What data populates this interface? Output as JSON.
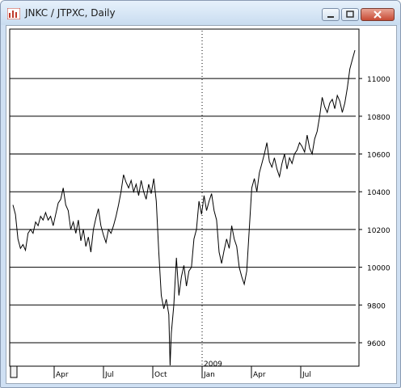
{
  "window": {
    "title": "JNKC / JTPXC, Daily",
    "controls": [
      "minimize",
      "maximize",
      "close"
    ],
    "close_color": "#c74a34"
  },
  "chart_data": {
    "type": "line",
    "series": [
      {
        "points": [
          [
            0,
            10330
          ],
          [
            2,
            10280
          ],
          [
            4,
            10150
          ],
          [
            6,
            10100
          ],
          [
            8,
            10120
          ],
          [
            10,
            10090
          ],
          [
            12,
            10180
          ],
          [
            14,
            10200
          ],
          [
            16,
            10180
          ],
          [
            18,
            10240
          ],
          [
            20,
            10220
          ],
          [
            22,
            10270
          ],
          [
            24,
            10250
          ],
          [
            26,
            10290
          ],
          [
            28,
            10250
          ],
          [
            30,
            10270
          ],
          [
            32,
            10220
          ],
          [
            34,
            10280
          ],
          [
            36,
            10340
          ],
          [
            38,
            10360
          ],
          [
            40,
            10420
          ],
          [
            42,
            10330
          ],
          [
            44,
            10300
          ],
          [
            46,
            10200
          ],
          [
            48,
            10240
          ],
          [
            50,
            10180
          ],
          [
            52,
            10250
          ],
          [
            54,
            10140
          ],
          [
            56,
            10200
          ],
          [
            58,
            10110
          ],
          [
            60,
            10160
          ],
          [
            62,
            10080
          ],
          [
            64,
            10200
          ],
          [
            66,
            10260
          ],
          [
            68,
            10310
          ],
          [
            70,
            10220
          ],
          [
            72,
            10170
          ],
          [
            74,
            10130
          ],
          [
            76,
            10200
          ],
          [
            78,
            10180
          ],
          [
            80,
            10220
          ],
          [
            82,
            10270
          ],
          [
            84,
            10330
          ],
          [
            86,
            10400
          ],
          [
            88,
            10490
          ],
          [
            90,
            10450
          ],
          [
            92,
            10420
          ],
          [
            94,
            10460
          ],
          [
            96,
            10400
          ],
          [
            98,
            10440
          ],
          [
            100,
            10380
          ],
          [
            102,
            10460
          ],
          [
            104,
            10400
          ],
          [
            106,
            10360
          ],
          [
            108,
            10440
          ],
          [
            110,
            10390
          ],
          [
            112,
            10470
          ],
          [
            114,
            10350
          ],
          [
            116,
            10080
          ],
          [
            118,
            9850
          ],
          [
            120,
            9780
          ],
          [
            122,
            9830
          ],
          [
            124,
            9750
          ],
          [
            125,
            9480
          ],
          [
            126,
            9650
          ],
          [
            128,
            9800
          ],
          [
            130,
            10050
          ],
          [
            132,
            9850
          ],
          [
            134,
            9950
          ],
          [
            136,
            10010
          ],
          [
            138,
            9900
          ],
          [
            140,
            9980
          ],
          [
            142,
            10000
          ],
          [
            144,
            10150
          ],
          [
            146,
            10200
          ],
          [
            148,
            10350
          ],
          [
            150,
            10280
          ],
          [
            152,
            10380
          ],
          [
            154,
            10300
          ],
          [
            156,
            10350
          ],
          [
            158,
            10390
          ],
          [
            160,
            10300
          ],
          [
            162,
            10250
          ],
          [
            164,
            10080
          ],
          [
            166,
            10020
          ],
          [
            168,
            10090
          ],
          [
            170,
            10150
          ],
          [
            172,
            10100
          ],
          [
            174,
            10220
          ],
          [
            176,
            10150
          ],
          [
            178,
            10110
          ],
          [
            180,
            10000
          ],
          [
            182,
            9950
          ],
          [
            184,
            9910
          ],
          [
            186,
            9980
          ],
          [
            188,
            10200
          ],
          [
            190,
            10420
          ],
          [
            192,
            10470
          ],
          [
            194,
            10400
          ],
          [
            196,
            10500
          ],
          [
            198,
            10550
          ],
          [
            200,
            10600
          ],
          [
            202,
            10660
          ],
          [
            204,
            10560
          ],
          [
            206,
            10530
          ],
          [
            208,
            10580
          ],
          [
            210,
            10520
          ],
          [
            212,
            10480
          ],
          [
            214,
            10550
          ],
          [
            216,
            10600
          ],
          [
            218,
            10520
          ],
          [
            220,
            10580
          ],
          [
            222,
            10550
          ],
          [
            224,
            10600
          ],
          [
            226,
            10620
          ],
          [
            228,
            10660
          ],
          [
            230,
            10640
          ],
          [
            232,
            10610
          ],
          [
            234,
            10700
          ],
          [
            236,
            10630
          ],
          [
            238,
            10600
          ],
          [
            240,
            10680
          ],
          [
            242,
            10720
          ],
          [
            244,
            10800
          ],
          [
            246,
            10900
          ],
          [
            248,
            10850
          ],
          [
            250,
            10820
          ],
          [
            252,
            10870
          ],
          [
            254,
            10890
          ],
          [
            256,
            10840
          ],
          [
            258,
            10910
          ],
          [
            260,
            10880
          ],
          [
            262,
            10820
          ],
          [
            264,
            10870
          ],
          [
            266,
            10950
          ],
          [
            268,
            11050
          ],
          [
            270,
            11100
          ],
          [
            272,
            11150
          ]
        ]
      }
    ],
    "y_ticks": [
      "11000",
      "10800",
      "10600",
      "10400",
      "10200",
      "10000",
      "9800",
      "9600"
    ],
    "x_ticks": [
      "Apr",
      "Jul",
      "Oct",
      "Jan",
      "Apr",
      "Jul"
    ],
    "year_marker": "2009",
    "grid": "horizontal lines at each y tick; dotted vertical line at year boundary",
    "line_color": "#000000"
  }
}
